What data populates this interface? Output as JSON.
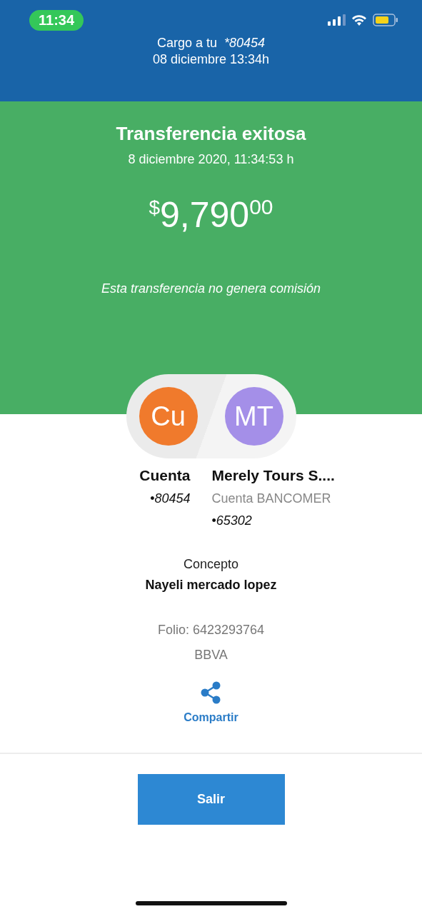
{
  "status_bar": {
    "time": "11:34"
  },
  "header": {
    "label": "Cargo a tu",
    "account": "*80454",
    "date": "08 diciembre 13:34h"
  },
  "result": {
    "title": "Transferencia exitosa",
    "datetime": "8 diciembre 2020, 11:34:53 h",
    "currency": "$",
    "amount": "9,790",
    "cents": "00",
    "note": "Esta transferencia no genera comisión"
  },
  "parties": [
    {
      "initials": "Cu",
      "color": "#f07a2c",
      "name": "Cuenta",
      "account": "•*80454*"
    },
    {
      "initials": "MT",
      "color": "#a48fe8",
      "name": "Merely Tours S....",
      "detail": "Cuenta BANCOMER",
      "account": "•*65302*"
    }
  ],
  "concept": {
    "label": "Concepto",
    "value": "Nayeli mercado lopez"
  },
  "folio": "Folio: 6423293764",
  "bank": "BBVA",
  "share": {
    "label": "Compartir"
  },
  "exit_button": "Salir"
}
